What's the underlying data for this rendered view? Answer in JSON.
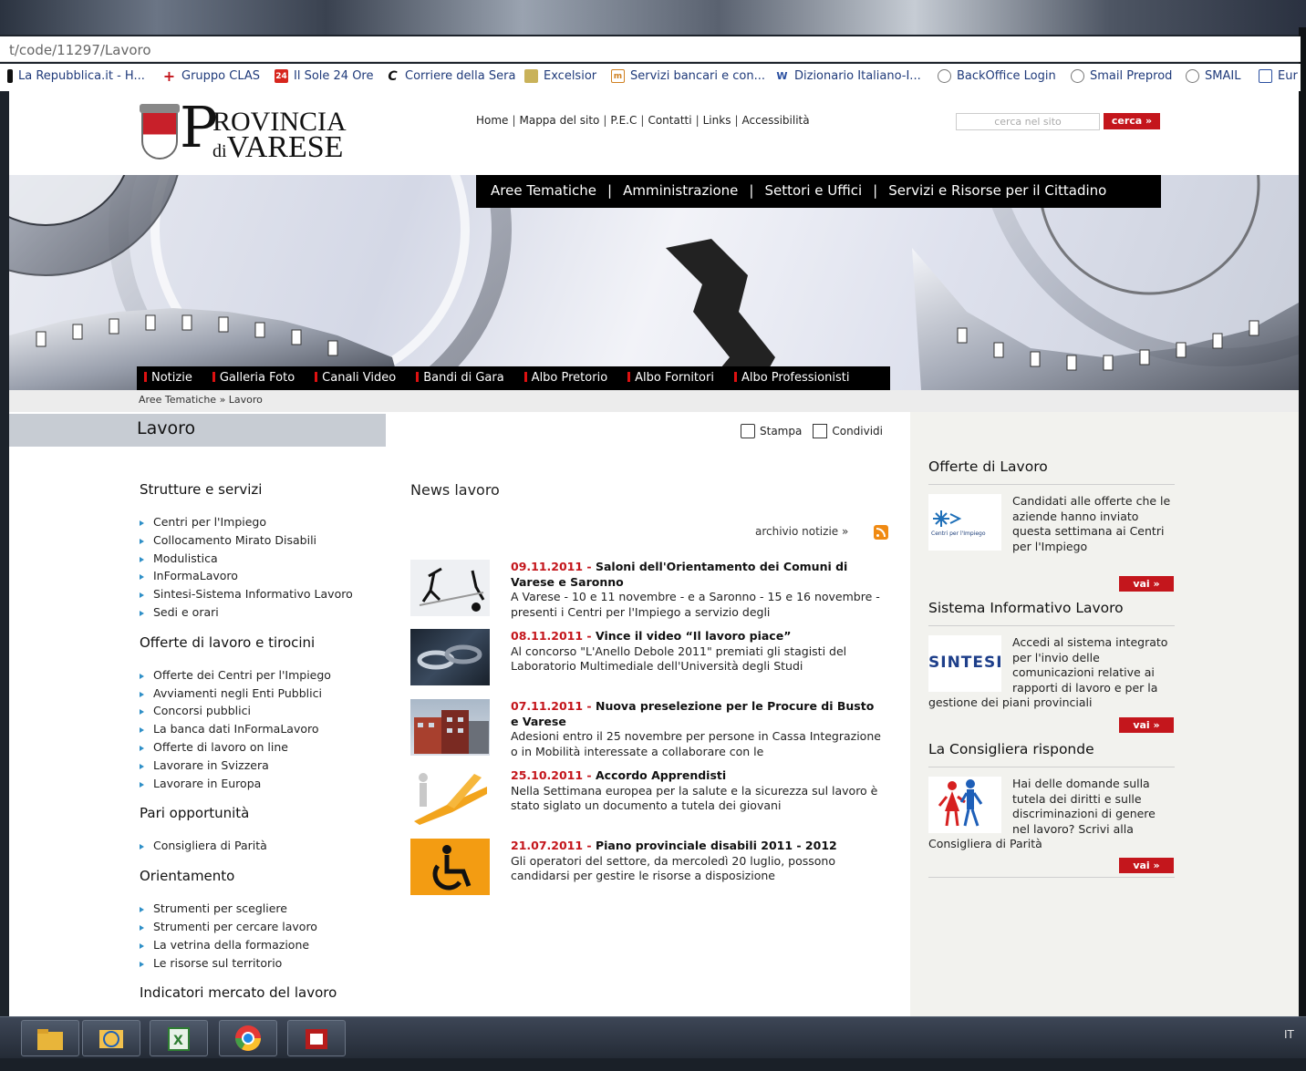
{
  "browser": {
    "url": "t/code/11297/Lavoro",
    "bookmarks": [
      "La Repubblica.it - H...",
      "Gruppo CLAS",
      "Il Sole 24 Ore",
      "Corriere della Sera",
      "Excelsior",
      "Servizi bancari e con...",
      "Dizionario Italiano-I...",
      "BackOffice Login",
      "Smail Preprod",
      "SMAIL",
      "Eur"
    ]
  },
  "header": {
    "logo": {
      "letter": "P",
      "line1": "ROVINCIA",
      "line2_small": "di",
      "line2": "VARESE"
    },
    "toplinks": [
      "Home",
      "Mappa del sito",
      "P.E.C",
      "Contatti",
      "Links",
      "Accessibilità"
    ],
    "search_placeholder": "cerca nel sito",
    "search_button": "cerca »"
  },
  "mainnav": [
    "Aree Tematiche",
    "Amministrazione",
    "Settori e Uffici",
    "Servizi e Risorse per il Cittadino"
  ],
  "subnav": [
    "Notizie",
    "Galleria Foto",
    "Canali Video",
    "Bandi di Gara",
    "Albo Pretorio",
    "Albo Fornitori",
    "Albo Professionisti"
  ],
  "breadcrumb": "Aree Tematiche » Lavoro",
  "page_title": "Lavoro",
  "tools": {
    "print": "Stampa",
    "share": "Condividi"
  },
  "leftmenu": [
    {
      "heading": "Strutture e servizi",
      "items": [
        "Centri per l'Impiego",
        "Collocamento Mirato Disabili",
        "Modulistica",
        "InFormaLavoro",
        "Sintesi-Sistema Informativo Lavoro",
        "Sedi e orari"
      ]
    },
    {
      "heading": "Offerte di lavoro e tirocini",
      "items": [
        "Offerte dei Centri per l'Impiego",
        "Avviamenti negli Enti Pubblici",
        "Concorsi pubblici",
        "La banca dati InFormaLavoro",
        "Offerte di lavoro on line",
        "Lavorare in Svizzera",
        "Lavorare in Europa"
      ]
    },
    {
      "heading": "Pari opportunità",
      "items": [
        "Consigliera di Parità"
      ]
    },
    {
      "heading": "Orientamento",
      "items": [
        "Strumenti per scegliere",
        "Strumenti per cercare lavoro",
        "La vetrina della formazione",
        "Le risorse sul territorio"
      ]
    },
    {
      "heading": "Indicatori mercato del lavoro",
      "items": []
    }
  ],
  "news": {
    "title": "News lavoro",
    "archive": "archivio notizie »",
    "items": [
      {
        "date": "09.11.2011",
        "sep": " - ",
        "headline": "Saloni dell'Orientamento dei Comuni di Varese e Saronno",
        "body": "A Varese - 10 e 11 novembre - e a Saronno - 15 e 16 novembre - presenti i Centri per l'Impiego a servizio degli"
      },
      {
        "date": "08.11.2011",
        "sep": " - ",
        "headline": "Vince il video “Il lavoro piace”",
        "body": "Al concorso \"L'Anello Debole 2011\" premiati gli stagisti del Laboratorio Multimediale dell'Università degli Studi"
      },
      {
        "date": "07.11.2011",
        "sep": " - ",
        "headline": "Nuova preselezione per le Procure di Busto e Varese",
        "body": "Adesioni entro il 25 novembre per persone in Cassa Integrazione o in Mobilità interessate a collaborare con le"
      },
      {
        "date": "25.10.2011",
        "sep": " - ",
        "headline": "Accordo Apprendisti",
        "body": "Nella Settimana europea per la salute e la sicurezza sul lavoro è stato siglato un documento a tutela dei giovani"
      },
      {
        "date": "21.07.2011",
        "sep": " - ",
        "headline": "Piano provinciale disabili 2011 - 2012",
        "body": "Gli operatori del settore, da mercoledì 20 luglio, possono candidarsi per gestire le risorse a disposizione"
      }
    ]
  },
  "right": [
    {
      "heading": "Offerte di Lavoro",
      "img_label": "Centri per l'Impiego",
      "text": "Candidati alle offerte che le aziende hanno inviato questa settimana ai Centri per l'Impiego",
      "button": "vai »"
    },
    {
      "heading": "Sistema Informativo Lavoro",
      "img_label": "SINTESI",
      "text": "Accedi al sistema integrato per l'invio delle comunicazioni relative ai rapporti di lavoro e per la gestione dei piani provinciali",
      "button": "vai »"
    },
    {
      "heading": "La Consigliera risponde",
      "img_label": "",
      "text": "Hai delle domande sulla tutela dei diritti e sulle discriminazioni di genere nel lavoro? Scrivi alla Consigliera di Parità",
      "button": "vai »"
    }
  ],
  "taskbar": {
    "lang": "IT",
    "apps": [
      "explorer-icon",
      "outlook-icon",
      "excel-icon",
      "chrome-icon",
      "access-icon"
    ]
  }
}
